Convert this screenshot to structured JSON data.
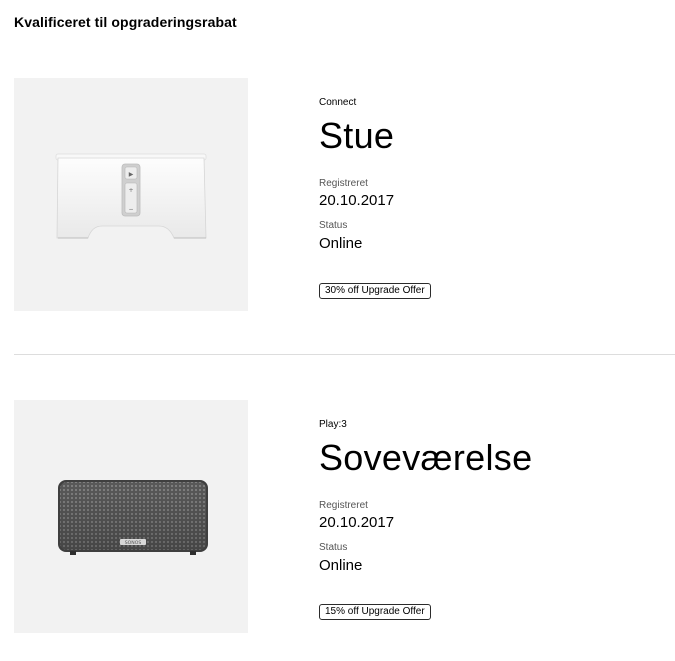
{
  "header": {
    "title": "Kvalificeret til opgraderingsrabat"
  },
  "devices": [
    {
      "model": "Connect",
      "room": "Stue",
      "registered_label": "Registreret",
      "registered_date": "20.10.2017",
      "status_label": "Status",
      "status_value": "Online",
      "offer": "30% off Upgrade Offer"
    },
    {
      "model": "Play:3",
      "room": "Soveværelse",
      "registered_label": "Registreret",
      "registered_date": "20.10.2017",
      "status_label": "Status",
      "status_value": "Online",
      "offer": "15% off Upgrade Offer",
      "brand_mark": "SONOS"
    }
  ],
  "colors": {
    "image_background": "#f2f2f2",
    "divider": "#dddddd",
    "badge_border": "#2b2b2b"
  }
}
